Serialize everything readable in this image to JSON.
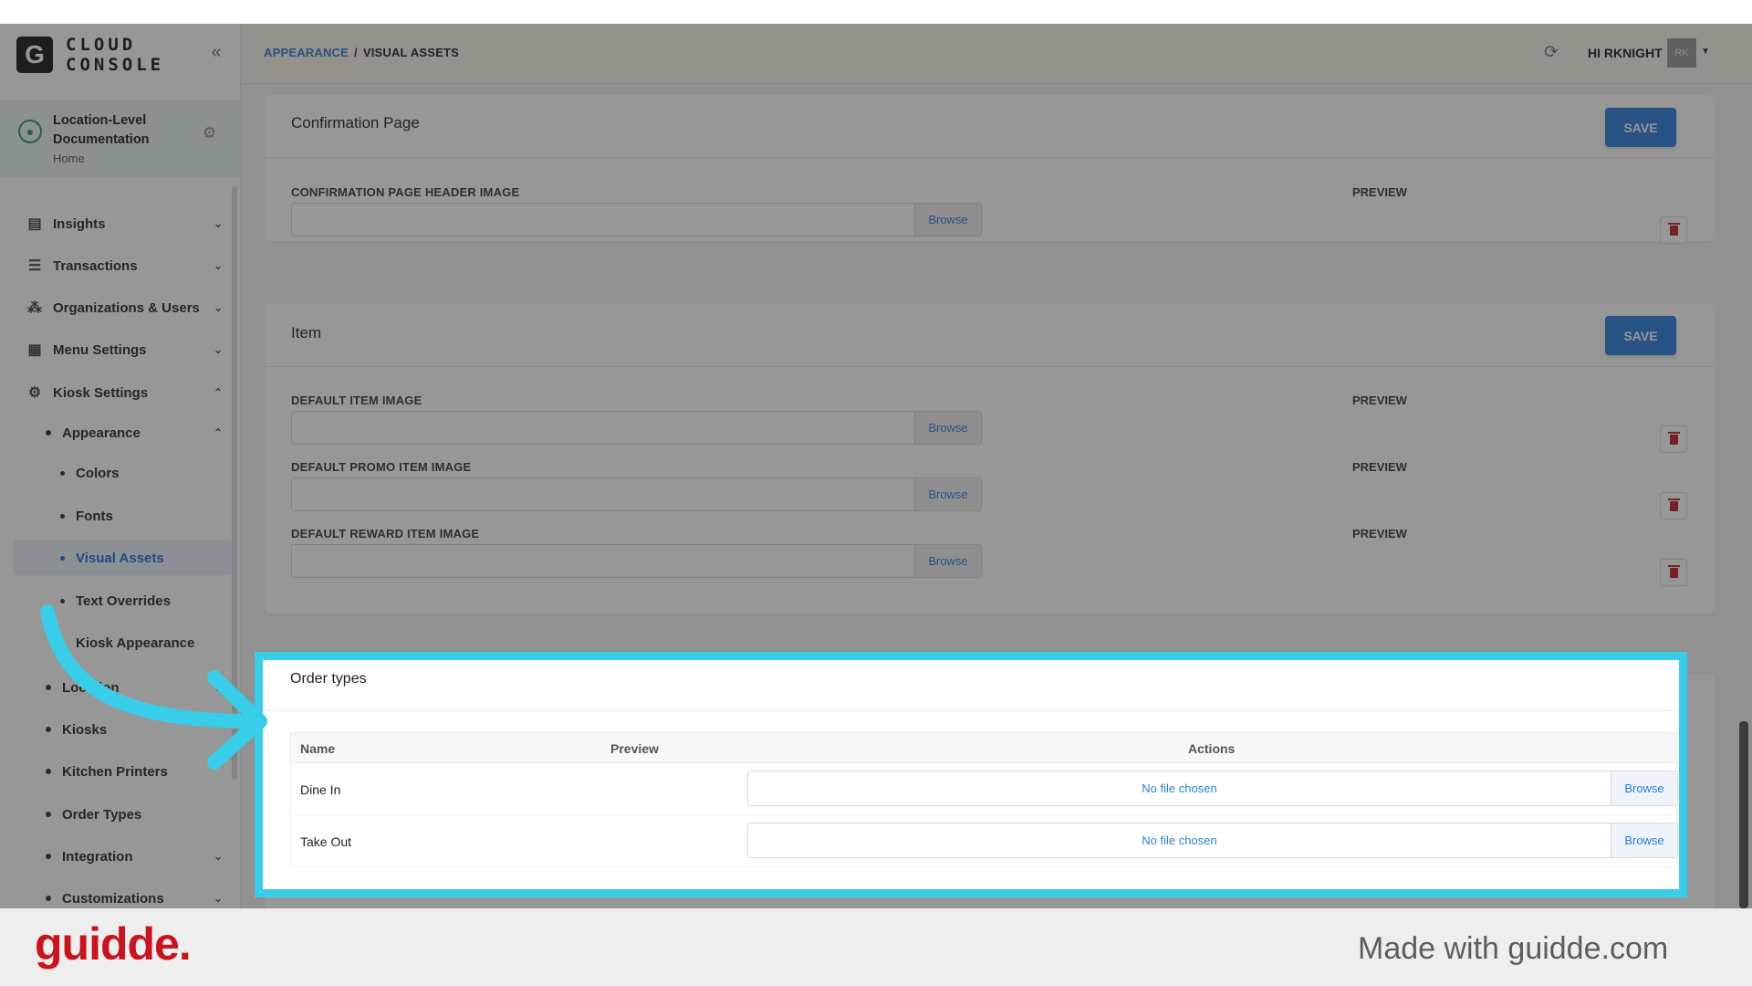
{
  "logo": {
    "letter": "G",
    "line1": "CLOUD",
    "line2": "CONSOLE"
  },
  "location": {
    "title": "Location-Level Documentation",
    "subtitle": "Home"
  },
  "nav": {
    "insights": "Insights",
    "transactions": "Transactions",
    "organizations": "Organizations & Users",
    "menu_settings": "Menu Settings",
    "kiosk_settings": "Kiosk Settings",
    "appearance": "Appearance",
    "colors": "Colors",
    "fonts": "Fonts",
    "visual_assets": "Visual Assets",
    "text_overrides": "Text Overrides",
    "kiosk_appearance": "Kiosk Appearance",
    "location": "Location",
    "kiosks": "Kiosks",
    "kitchen_printers": "Kitchen Printers",
    "order_types": "Order Types",
    "integration": "Integration",
    "customizations": "Customizations"
  },
  "header": {
    "crumb_parent": "APPEARANCE",
    "crumb_sep": "/",
    "crumb_current": "VISUAL ASSETS",
    "greeting": "HI RKNIGHT",
    "avatar_initials": "RK"
  },
  "confirmation": {
    "title": "Confirmation Page",
    "save": "SAVE",
    "field_label": "CONFIRMATION PAGE HEADER IMAGE",
    "preview_label": "PREVIEW",
    "browse": "Browse"
  },
  "item": {
    "title": "Item",
    "save": "SAVE",
    "fields": [
      {
        "label": "DEFAULT ITEM IMAGE",
        "preview": "PREVIEW",
        "browse": "Browse"
      },
      {
        "label": "DEFAULT PROMO ITEM IMAGE",
        "preview": "PREVIEW",
        "browse": "Browse"
      },
      {
        "label": "DEFAULT REWARD ITEM IMAGE",
        "preview": "PREVIEW",
        "browse": "Browse"
      }
    ]
  },
  "order_types": {
    "title": "Order types",
    "columns": {
      "name": "Name",
      "preview": "Preview",
      "actions": "Actions"
    },
    "rows": [
      {
        "name": "Dine In",
        "file": "No file chosen",
        "browse": "Browse"
      },
      {
        "name": "Take Out",
        "file": "No file chosen",
        "browse": "Browse"
      }
    ]
  },
  "footer": {
    "brand": "guidde.",
    "made_with": "Made with guidde.com"
  },
  "colors": {
    "highlight": "#38cde8",
    "primary": "#2f7fe0",
    "brand_red": "#c8141c",
    "link": "#2a7fd4"
  }
}
